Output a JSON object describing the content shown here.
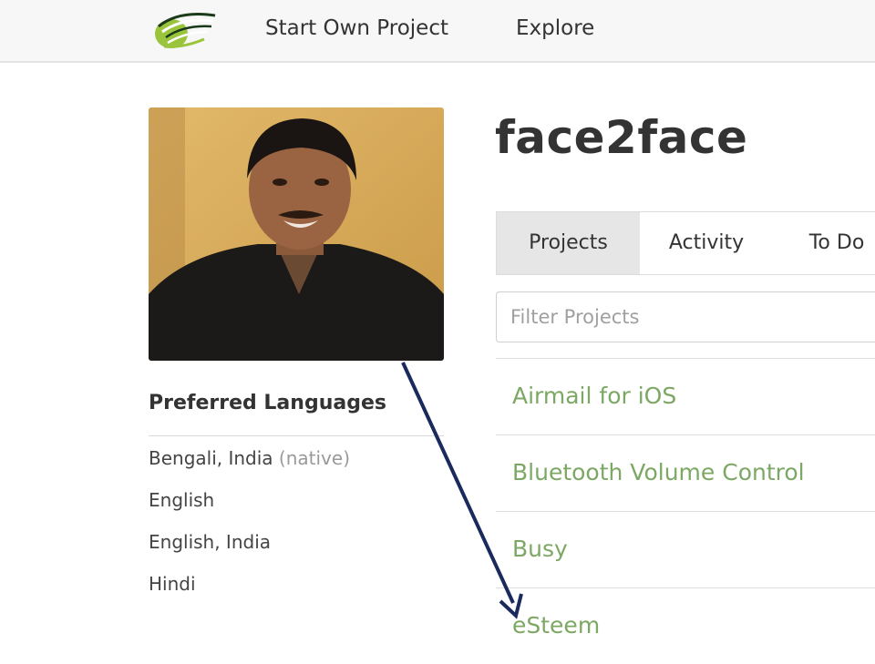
{
  "nav": {
    "logo_icon": "crowdin-logo-icon",
    "start_own_project": "Start Own Project",
    "explore": "Explore"
  },
  "profile": {
    "username": "face2face",
    "avatar_icon": "user-avatar-photo"
  },
  "languages": {
    "heading": "Preferred Languages",
    "items": [
      {
        "name": "Bengali, India",
        "tag": "(native)"
      },
      {
        "name": "English",
        "tag": ""
      },
      {
        "name": "English, India",
        "tag": ""
      },
      {
        "name": "Hindi",
        "tag": ""
      }
    ]
  },
  "tabs": [
    {
      "label": "Projects",
      "active": true
    },
    {
      "label": "Activity",
      "active": false
    },
    {
      "label": "To Do",
      "active": false
    }
  ],
  "filter": {
    "placeholder": "Filter Projects",
    "value": ""
  },
  "projects": [
    {
      "name": "Airmail for iOS"
    },
    {
      "name": "Bluetooth Volume Control"
    },
    {
      "name": "Busy"
    },
    {
      "name": "eSteem"
    }
  ],
  "colors": {
    "project_link": "#7ca864",
    "active_tab": "#e6e6e6",
    "annotation_arrow": "#1a2a5c",
    "logo_green": "#9ac43c"
  }
}
